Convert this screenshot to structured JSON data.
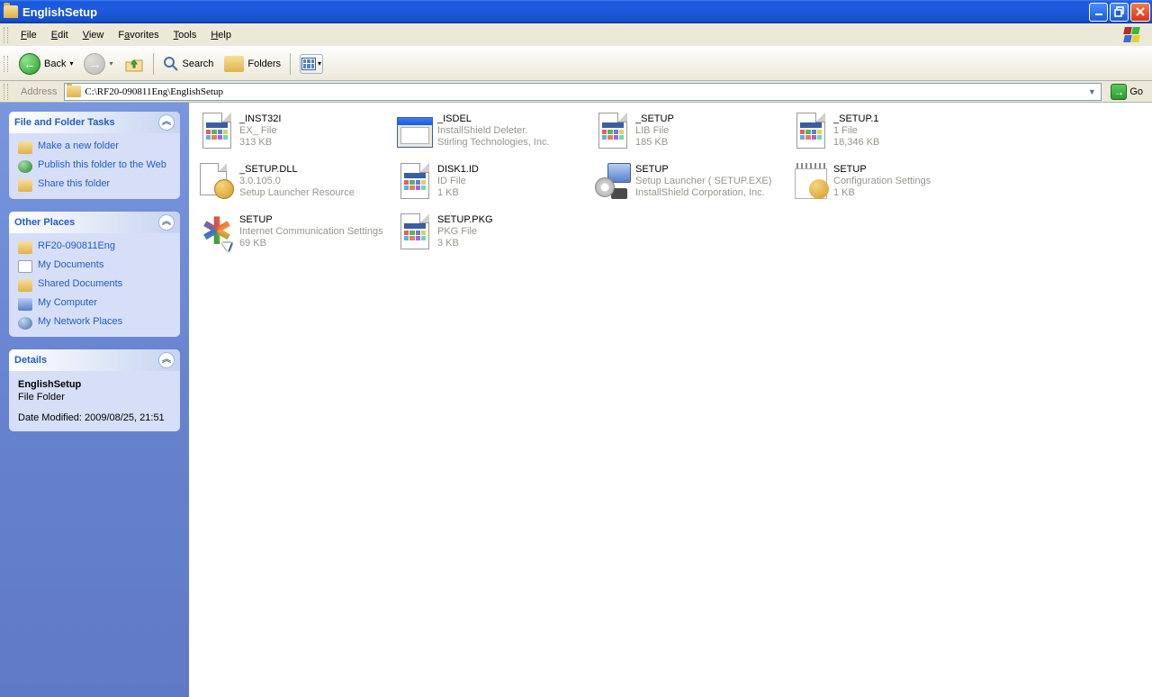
{
  "titlebar": {
    "title": "EnglishSetup"
  },
  "menubar": {
    "items": [
      "File",
      "Edit",
      "View",
      "Favorites",
      "Tools",
      "Help"
    ]
  },
  "toolbar": {
    "back": "Back",
    "search": "Search",
    "folders": "Folders"
  },
  "address": {
    "label": "Address",
    "path": "C:\\RF20-090811Eng\\EnglishSetup",
    "go": "Go"
  },
  "sidebar": {
    "tasks": {
      "title": "File and Folder Tasks",
      "items": [
        {
          "label": "Make a new folder",
          "icon": "folder"
        },
        {
          "label": "Publish this folder to the Web",
          "icon": "globe"
        },
        {
          "label": "Share this folder",
          "icon": "folder"
        }
      ]
    },
    "places": {
      "title": "Other Places",
      "items": [
        {
          "label": "RF20-090811Eng",
          "icon": "folder"
        },
        {
          "label": "My Documents",
          "icon": "doc"
        },
        {
          "label": "Shared Documents",
          "icon": "folder"
        },
        {
          "label": "My Computer",
          "icon": "pc"
        },
        {
          "label": "My Network Places",
          "icon": "net"
        }
      ]
    },
    "details": {
      "title": "Details",
      "name": "EnglishSetup",
      "type": "File Folder",
      "modified": "Date Modified: 2009/08/25, 21:51"
    }
  },
  "files": [
    {
      "name": "_INST32I",
      "line2": "EX_ File",
      "line3": "313 KB",
      "icon": "doc"
    },
    {
      "name": "_ISDEL",
      "line2": "InstallShield Deleter.",
      "line3": "Stirling Technologies, Inc.",
      "icon": "win"
    },
    {
      "name": "_SETUP",
      "line2": "LIB File",
      "line3": "185 KB",
      "icon": "doc"
    },
    {
      "name": "_SETUP.1",
      "line2": "1 File",
      "line3": "18,346 KB",
      "icon": "doc"
    },
    {
      "name": "_SETUP.DLL",
      "line2": "3.0.105.0",
      "line3": "Setup Launcher Resource",
      "icon": "gear"
    },
    {
      "name": "DISK1.ID",
      "line2": "ID File",
      "line3": "1 KB",
      "icon": "doc"
    },
    {
      "name": "SETUP",
      "line2": "Setup Launcher ( SETUP.EXE)",
      "line3": "InstallShield Corporation, Inc.",
      "icon": "setup"
    },
    {
      "name": "SETUP",
      "line2": "Configuration Settings",
      "line3": "1 KB",
      "icon": "note"
    },
    {
      "name": "SETUP",
      "line2": "Internet Communication Settings",
      "line3": "69 KB",
      "icon": "inet"
    },
    {
      "name": "SETUP.PKG",
      "line2": "PKG File",
      "line3": "3 KB",
      "icon": "doc"
    }
  ]
}
